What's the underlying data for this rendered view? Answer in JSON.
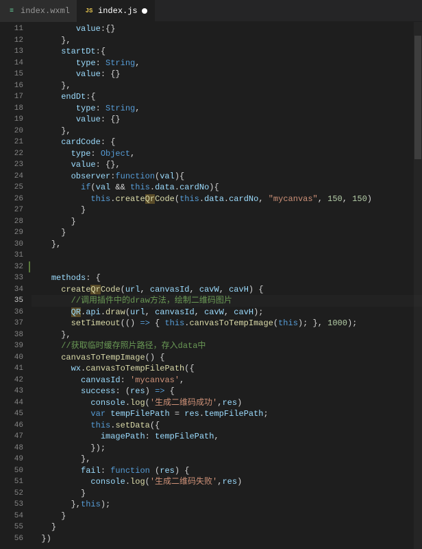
{
  "tabs": [
    {
      "label": "index.wxml",
      "iconType": "wxml",
      "active": false,
      "dirty": false
    },
    {
      "label": "index.js",
      "iconType": "js",
      "active": true,
      "dirty": true
    }
  ],
  "editor": {
    "firstLine": 11,
    "lastLine": 56,
    "currentLine": 35,
    "modifiedMarkerLine": 32
  },
  "code": {
    "l11": {
      "pre": "         ",
      "t1": "value",
      "punc1": ":{}"
    },
    "l12": {
      "pre": "      ",
      "t1": "}",
      "t2": ","
    },
    "l13": {
      "pre": "      ",
      "prop": "startDt",
      "punc": ":{"
    },
    "l14": {
      "pre": "         ",
      "prop": "type",
      "colon": ": ",
      "val": "String",
      "comma": ","
    },
    "l15": {
      "pre": "         ",
      "prop": "value",
      "colon": ": ",
      "val": "{}"
    },
    "l16": {
      "pre": "      ",
      "t1": "}",
      "t2": ","
    },
    "l17": {
      "pre": "      ",
      "prop": "endDt",
      "punc": ":{"
    },
    "l18": {
      "pre": "         ",
      "prop": "type",
      "colon": ": ",
      "val": "String",
      "comma": ","
    },
    "l19": {
      "pre": "         ",
      "prop": "value",
      "colon": ": ",
      "val": "{}"
    },
    "l20": {
      "pre": "      ",
      "t1": "}",
      "t2": ","
    },
    "l21": {
      "pre": "      ",
      "prop": "cardCode",
      "punc": ": {"
    },
    "l22": {
      "pre": "        ",
      "prop": "type",
      "colon": ": ",
      "val": "Object",
      "comma": ","
    },
    "l23": {
      "pre": "        ",
      "prop": "value",
      "colon": ": ",
      "val": "{}",
      "comma": ","
    },
    "l24": {
      "pre": "        ",
      "prop": "observer",
      "colon": ":",
      "kw": "function",
      "paren": "(",
      "param": "val",
      "close": "){"
    },
    "l25": {
      "pre": "          ",
      "kw": "if",
      "open": "(",
      "p1": "val",
      "amp": " && ",
      "this": "this",
      "dot1": ".",
      "d": "data",
      "dot2": ".",
      "cn": "cardNo",
      "close": "){"
    },
    "l26": {
      "pre": "            ",
      "this": "this",
      "dot": ".",
      "fnA": "create",
      "fnQr": "Qr",
      "fnB": "Code",
      "open": "(",
      "t2": "this",
      "d2": ".",
      "da": "data",
      "d3": ".",
      "cn": "cardNo",
      "c1": ", ",
      "s1": "\"mycanvas\"",
      "c2": ", ",
      "n1": "150",
      "c3": ", ",
      "n2": "150",
      "close": ")"
    },
    "l27": {
      "pre": "          ",
      "b": "}"
    },
    "l28": {
      "pre": "        ",
      "b": "}"
    },
    "l29": {
      "pre": "      ",
      "b": "}"
    },
    "l30": {
      "pre": "    ",
      "b": "},"
    },
    "l31": {
      "pre": ""
    },
    "l32": {
      "pre": ""
    },
    "l33": {
      "pre": "    ",
      "prop": "methods",
      "punc": ": {"
    },
    "l34": {
      "pre": "      ",
      "fnA": "create",
      "fnQr": "Qr",
      "fnB": "Code",
      "open": "(",
      "p1": "url",
      "c1": ", ",
      "p2": "canvasId",
      "c2": ", ",
      "p3": "cavW",
      "c3": ", ",
      "p4": "cavH",
      "close": ") {"
    },
    "l35": {
      "pre": "        ",
      "comment": "//调用插件中的draw方法，绘制二维码图片"
    },
    "l36": {
      "pre": "        ",
      "qr": "QR",
      "dot": ".",
      "api": "api",
      "dot2": ".",
      "fn": "draw",
      "open": "(",
      "p1": "url",
      "c1": ", ",
      "p2": "canvasId",
      "c2": ", ",
      "p3": "cavW",
      "c3": ", ",
      "p4": "cavH",
      "close": ");"
    },
    "l37": {
      "pre": "        ",
      "fn": "setTimeout",
      "open": "(() ",
      "arrow": "=>",
      "b1": " { ",
      "this": "this",
      "dot": ".",
      "fn2": "canvasToTempImage",
      "open2": "(",
      "t2": "this",
      "close2": "); }, ",
      "n": "1000",
      "end": ");"
    },
    "l38": {
      "pre": "      ",
      "b": "},"
    },
    "l39": {
      "pre": "      ",
      "comment": "//获取临时缓存照片路径，存入data中"
    },
    "l40": {
      "pre": "      ",
      "fn": "canvasToTempImage",
      "open": "() {"
    },
    "l41": {
      "pre": "        ",
      "wx": "wx",
      "dot": ".",
      "fn": "canvasToTempFilePath",
      "open": "({"
    },
    "l42": {
      "pre": "          ",
      "prop": "canvasId",
      "colon": ": ",
      "str": "'mycanvas'",
      "comma": ","
    },
    "l43": {
      "pre": "          ",
      "prop": "success",
      "colon": ": (",
      "p": "res",
      "rest": ") ",
      "arrow": "=>",
      "b": " {"
    },
    "l44": {
      "pre": "            ",
      "c": "console",
      "dot": ".",
      "fn": "log",
      "open": "(",
      "str": "'生成二维码成功'",
      "c1": ",",
      "r": "res",
      "close": ")"
    },
    "l45": {
      "pre": "            ",
      "kw": "var",
      "sp": " ",
      "v": "tempFilePath",
      "eq": " = ",
      "r": "res",
      "dot": ".",
      "p": "tempFilePath",
      "semi": ";"
    },
    "l46": {
      "pre": "            ",
      "this": "this",
      "dot": ".",
      "fn": "setData",
      "open": "({"
    },
    "l47": {
      "pre": "              ",
      "prop": "imagePath",
      "colon": ": ",
      "v": "tempFilePath",
      "comma": ","
    },
    "l48": {
      "pre": "            ",
      "b": "});"
    },
    "l49": {
      "pre": "          ",
      "b": "},"
    },
    "l50": {
      "pre": "          ",
      "prop": "fail",
      "colon": ": ",
      "kw": "function",
      "open": " (",
      "p": "res",
      "close": ") {"
    },
    "l51": {
      "pre": "            ",
      "c": "console",
      "dot": ".",
      "fn": "log",
      "open": "(",
      "str": "'生成二维码失败'",
      "c1": ",",
      "r": "res",
      "close": ")"
    },
    "l52": {
      "pre": "          ",
      "b": "}"
    },
    "l53": {
      "pre": "        ",
      "b1": "},",
      "this": "this",
      "b2": ");"
    },
    "l54": {
      "pre": "      ",
      "b": "}"
    },
    "l55": {
      "pre": "    ",
      "b": "}"
    },
    "l56": {
      "pre": "  ",
      "b": "})"
    }
  }
}
